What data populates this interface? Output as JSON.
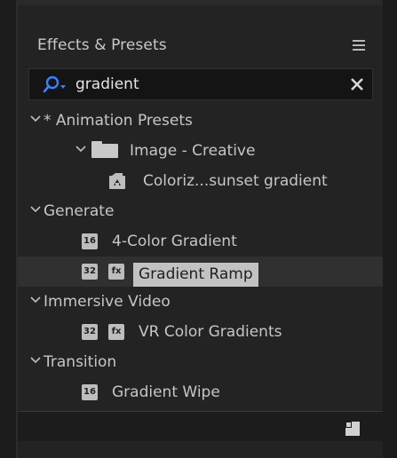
{
  "panel": {
    "title": "Effects & Presets",
    "menu_icon": "hamburger-menu-icon"
  },
  "search": {
    "value": "gradient",
    "icon": "search-dropdown-icon",
    "clear_icon": "close-icon"
  },
  "tree": {
    "animation_presets": {
      "label": "* Animation Presets",
      "expanded": true,
      "folder": {
        "label": "Image - Creative",
        "expanded": true,
        "items": [
          {
            "label": "Coloriz...sunset gradient",
            "icon": "animation-preset-icon"
          }
        ]
      }
    },
    "generate": {
      "label": "Generate",
      "expanded": true,
      "items": [
        {
          "label": "4-Color Gradient",
          "badges": [
            "16"
          ],
          "selected": false
        },
        {
          "label": "Gradient Ramp",
          "badges": [
            "32",
            "fx"
          ],
          "selected": true
        }
      ]
    },
    "immersive_video": {
      "label": "Immersive Video",
      "expanded": true,
      "items": [
        {
          "label": "VR Color Gradients",
          "badges": [
            "32",
            "fx"
          ],
          "selected": false
        }
      ]
    },
    "transition": {
      "label": "Transition",
      "expanded": true,
      "items": [
        {
          "label": "Gradient Wipe",
          "badges": [
            "16"
          ],
          "selected": false
        }
      ]
    }
  },
  "footer": {
    "new_bin_icon": "new-bin-icon"
  },
  "colors": {
    "panel_bg": "#232323",
    "search_bg": "#141414",
    "text": "#c6c6c6",
    "selected_row": "#303030",
    "selected_label_bg": "#c2c2c2"
  }
}
